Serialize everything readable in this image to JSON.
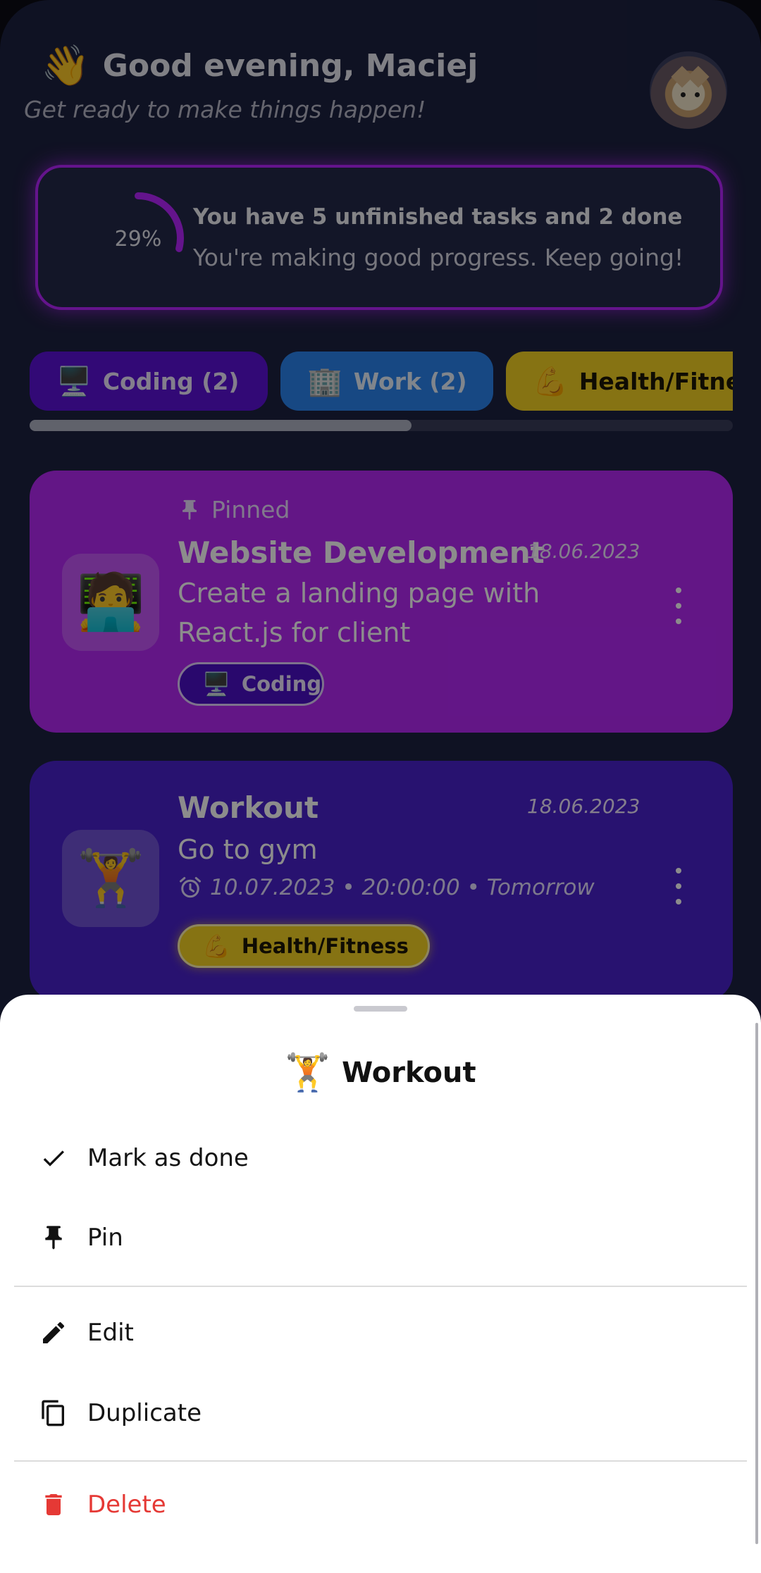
{
  "header": {
    "wave_emoji": "👋",
    "greeting": "Good evening, Maciej",
    "subtitle": "Get ready to make things happen!"
  },
  "progress": {
    "percent_label": "29%",
    "percent_value": 29,
    "title": "You have 5 unfinished tasks and 2 done",
    "subtitle": "You're making good progress. Keep going!",
    "accent_color": "#b726ff"
  },
  "categories": [
    {
      "emoji": "🖥️",
      "label": "Coding (2)",
      "color": "#5b12d8"
    },
    {
      "emoji": "🏢",
      "label": "Work (2)",
      "color": "#2b84ee"
    },
    {
      "emoji": "💪",
      "label": "Health/Fitness",
      "color": "#f5d123"
    }
  ],
  "tasks": [
    {
      "emoji": "🧑‍💻",
      "pinned_label": "Pinned",
      "title": "Website Development",
      "date": "18.06.2023",
      "description": "Create a landing page with React.js for client",
      "category_emoji": "🖥️",
      "category_label": "Coding",
      "color": "#b528f5"
    },
    {
      "emoji": "🏋️",
      "title": "Workout",
      "date": "18.06.2023",
      "description": "Go to gym",
      "reminder": "10.07.2023 • 20:00:00 • Tomorrow",
      "category_emoji": "💪",
      "category_label": "Health/Fitness",
      "color": "#4a22cc"
    }
  ],
  "sheet": {
    "emoji": "🏋️",
    "title": "Workout",
    "items": [
      {
        "label": "Mark as done",
        "icon": "check-icon"
      },
      {
        "label": "Pin",
        "icon": "pin-icon"
      },
      {
        "label": "Edit",
        "icon": "pencil-icon"
      },
      {
        "label": "Duplicate",
        "icon": "copy-icon"
      },
      {
        "label": "Delete",
        "icon": "trash-icon",
        "color": "#e53935"
      }
    ]
  }
}
